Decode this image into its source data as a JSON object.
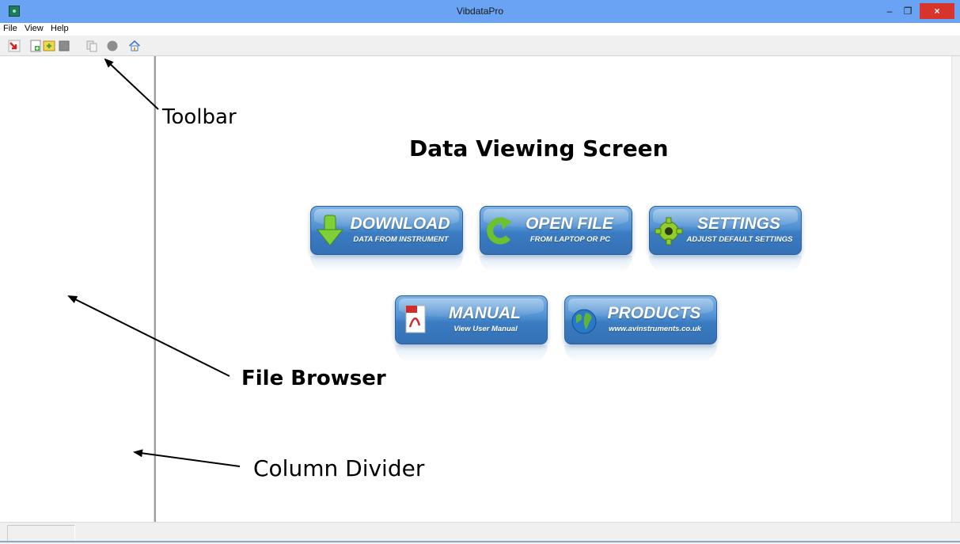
{
  "window": {
    "title": "VibdataPro",
    "controls": {
      "minimize": "–",
      "restore": "❐",
      "close": "×"
    }
  },
  "menu": [
    "File",
    "View",
    "Help"
  ],
  "toolbar": {
    "icons": [
      "exit-icon",
      "new-file-icon",
      "add-file-icon",
      "stop-icon",
      "copy-icon",
      "record-icon",
      "home-icon"
    ]
  },
  "main": {
    "buttons": [
      {
        "title": "DOWNLOAD",
        "subtitle": "DATA FROM INSTRUMENT",
        "icon": "download-arrow-icon"
      },
      {
        "title": "OPEN FILE",
        "subtitle": "FROM LAPTOP OR PC",
        "icon": "refresh-arrow-icon"
      },
      {
        "title": "SETTINGS",
        "subtitle": "ADJUST DEFAULT SETTINGS",
        "icon": "gear-icon"
      },
      {
        "title": "MANUAL",
        "subtitle": "View User Manual",
        "icon": "pdf-icon"
      },
      {
        "title": "PRODUCTS",
        "subtitle": "www.avinstruments.co.uk",
        "icon": "globe-icon"
      }
    ]
  },
  "annotations": {
    "toolbar": "Toolbar",
    "data_viewing_screen": "Data Viewing Screen",
    "file_browser": "File Browser",
    "column_divider": "Column Divider"
  },
  "colors": {
    "titlebar": "#6aa3f3",
    "close_button": "#d9342b",
    "button_blue": "#4f90d2"
  }
}
